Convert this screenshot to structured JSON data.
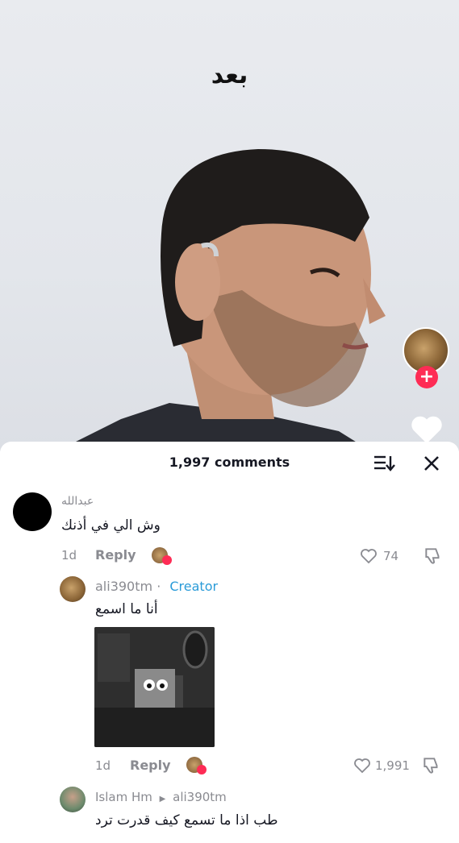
{
  "video": {
    "overlay_text": "بعد"
  },
  "side": {
    "avatar_icon": "creator-avatar",
    "follow_icon": "plus-icon",
    "like_icon": "heart-icon"
  },
  "comments_sheet": {
    "count_label": "1,997 comments",
    "sort_icon": "sort-icon",
    "close_icon": "close-icon"
  },
  "comments": [
    {
      "author": "عبدالله",
      "text": "وش الي في أذنك",
      "age": "1d",
      "reply_label": "Reply",
      "likes": "74"
    },
    {
      "author": "ali390tm",
      "separator": "·",
      "badge": "Creator",
      "text": "أنا ما اسمع",
      "age": "1d",
      "reply_label": "Reply",
      "likes": "1,991"
    },
    {
      "author": "Islam Hm",
      "reply_to": "ali390tm",
      "text": "طب اذا ما تسمع كيف قدرت ترد"
    }
  ]
}
